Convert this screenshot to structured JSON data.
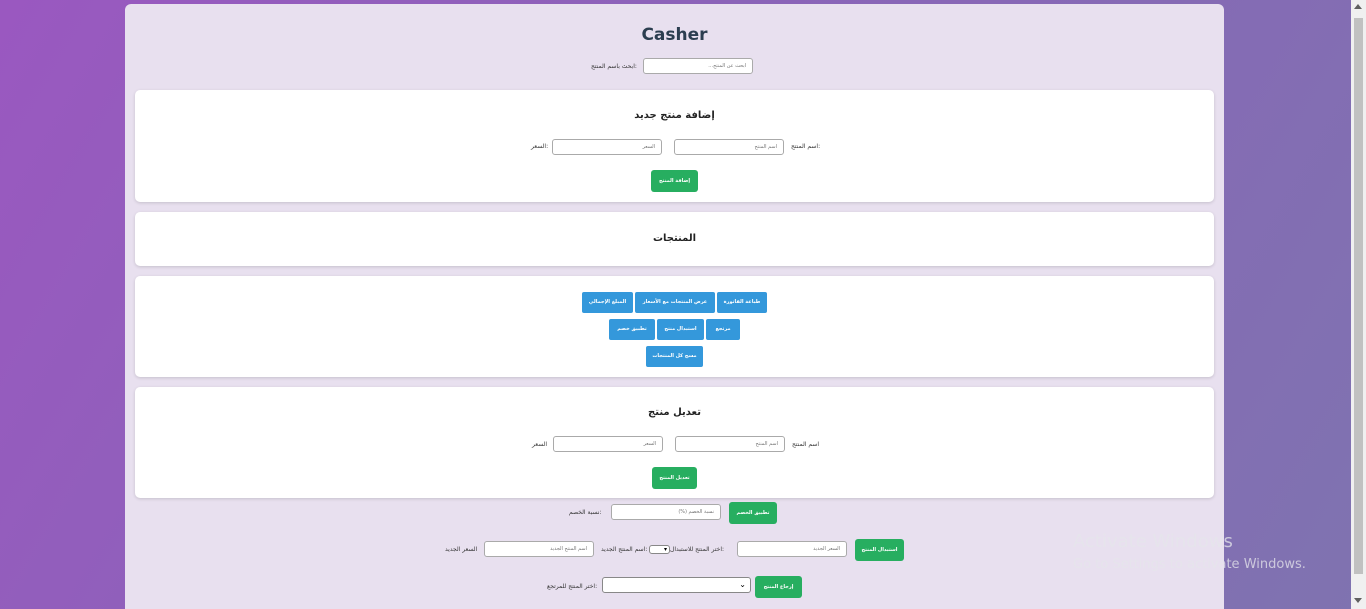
{
  "app": {
    "title": "Casher"
  },
  "search": {
    "label": "ابحث باسم المنتج:",
    "placeholder": "ابحث عن المنتج..."
  },
  "add_product": {
    "heading": "إضافة منتج جديد",
    "name_label": "اسم المنتج:",
    "name_placeholder": "اسم المنتج",
    "price_label": "السعر:",
    "price_placeholder": "السعر",
    "submit_label": "إضافة المنتج"
  },
  "products": {
    "heading": "المنتجات"
  },
  "actions": {
    "print_invoice": "طباعة الفاتورة",
    "show_with_prices": "عرض المنتجات مع الأسعار",
    "total_amount": "المبلغ الإجمالي",
    "returns": "مرتجع",
    "replace_product": "استبدال منتج",
    "apply_discount": "تطبيق خصم",
    "clear_all": "مسح كل المنتجات"
  },
  "edit_product": {
    "heading": "تعديل منتج",
    "name_label": "اسم المنتج",
    "name_placeholder": "اسم المنتج",
    "price_label": "السعر",
    "price_placeholder": "السعر",
    "submit_label": "تعديل المنتج"
  },
  "discount": {
    "label": "نسبة الخصم:",
    "placeholder": "نسبة الخصم (%)",
    "apply_label": "تطبيق الخصم"
  },
  "replace": {
    "select_label": "اختر المنتج للاستبدال:",
    "new_name_label": "اسم المنتج الجديد:",
    "new_name_placeholder": "اسم المنتج الجديد",
    "new_price_label": "السعر الجديد",
    "new_price_placeholder": "السعر الجديد",
    "submit_label": "استبدال المنتج"
  },
  "return": {
    "select_label": "اختر المنتج للمرتجع:",
    "submit_label": "إرجاع المنتج"
  },
  "watermark": {
    "title": "Activate Windows",
    "subtitle": "Go to Settings to activate Windows."
  }
}
